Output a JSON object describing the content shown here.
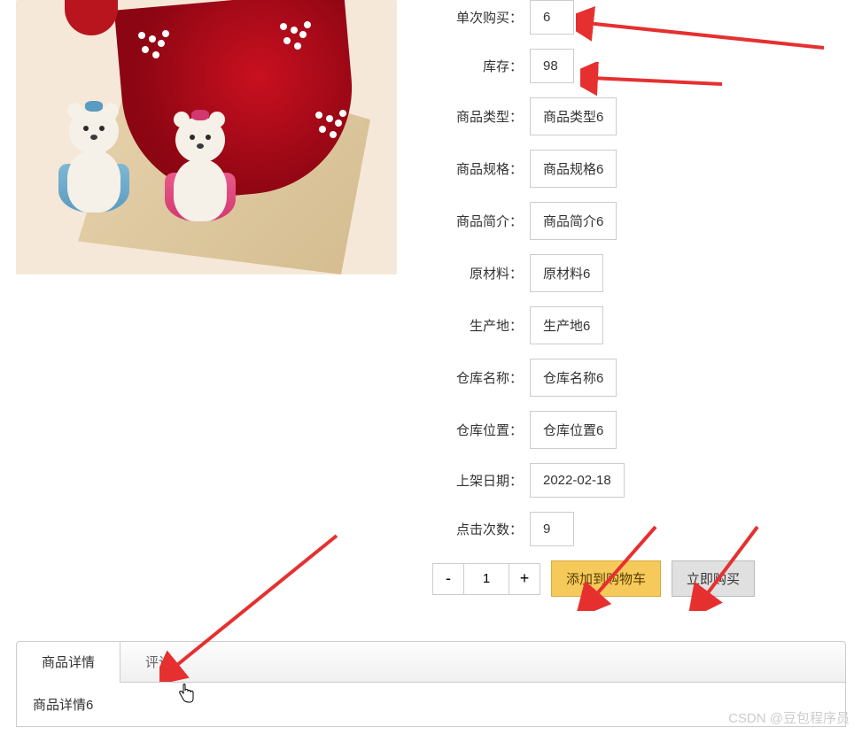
{
  "product": {
    "fields": [
      {
        "label": "单次购买：",
        "value": "6"
      },
      {
        "label": "库存：",
        "value": "98"
      },
      {
        "label": "商品类型：",
        "value": "商品类型6"
      },
      {
        "label": "商品规格：",
        "value": "商品规格6"
      },
      {
        "label": "商品简介：",
        "value": "商品简介6"
      },
      {
        "label": "原材料：",
        "value": "原材料6"
      },
      {
        "label": "生产地：",
        "value": "生产地6"
      },
      {
        "label": "仓库名称：",
        "value": "仓库名称6"
      },
      {
        "label": "仓库位置：",
        "value": "仓库位置6"
      },
      {
        "label": "上架日期：",
        "value": "2022-02-18"
      },
      {
        "label": "点击次数：",
        "value": "9"
      }
    ]
  },
  "quantity": {
    "minus": "-",
    "plus": "+",
    "value": "1"
  },
  "buttons": {
    "add_to_cart": "添加到购物车",
    "buy_now": "立即购买"
  },
  "tabs": {
    "detail": "商品详情",
    "reviews": "评论"
  },
  "detail_content": "商品详情6",
  "watermark": "CSDN @豆包程序员"
}
